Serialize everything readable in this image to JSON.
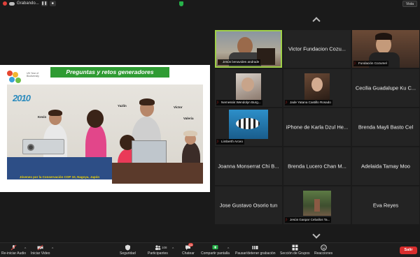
{
  "top": {
    "recording_label": "Grabando...",
    "view_label": "Vista"
  },
  "share": {
    "title": "Preguntas y retos generadores",
    "logo_text": "UN Year of Biodiversity",
    "logo_year": "2010",
    "names": [
      "Kevin",
      "Yazlin",
      "Victor",
      "Valeria",
      "Paula"
    ],
    "caption": "Jóvenes por la Conservación COP 10, Nagoya, Japón"
  },
  "gallery": [
    {
      "name": "Jesús benavides andrade",
      "kind": "video",
      "active": true
    },
    {
      "name": "Victor Fundacion Cozu...",
      "kind": "text",
      "active": false
    },
    {
      "name": "Fundación Cozumel",
      "kind": "video",
      "active": false
    },
    {
      "name": "Nemessis Wendolyn Burg...",
      "kind": "photo",
      "active": false
    },
    {
      "name": "Jade Yatana Castillo Rosado",
      "kind": "photo",
      "active": false
    },
    {
      "name": "Cecilia Guadalupe Ku C...",
      "kind": "text",
      "active": false
    },
    {
      "name": "Limberth Arceo",
      "kind": "photo",
      "active": false
    },
    {
      "name": "iPhone de Karla Dzul He...",
      "kind": "text",
      "active": false
    },
    {
      "name": "Brenda Mayli Basto Cel",
      "kind": "text",
      "active": false
    },
    {
      "name": "Joanna Monserrat Chi B...",
      "kind": "text",
      "active": false
    },
    {
      "name": "Brenda Lucero Chan M...",
      "kind": "text",
      "active": false
    },
    {
      "name": "Adelaida Tamay Moo",
      "kind": "text",
      "active": false
    },
    {
      "name": "Jose Gustavo Osorio tun",
      "kind": "text",
      "active": false
    },
    {
      "name": "Jesús Gaspar Ceballos Ta...",
      "kind": "photo",
      "active": false
    },
    {
      "name": "Eva Reyes",
      "kind": "text",
      "active": false
    }
  ],
  "toolbar": {
    "mute_label": "Re-iniciar Audio",
    "video_label": "Iniciar Video",
    "security_label": "Seguridad",
    "participants_label": "Participantes",
    "participants_count": "108",
    "chat_label": "Chatear",
    "chat_badge": "63",
    "share_label": "Compartir pantalla",
    "record_label": "Pausar/detener grabación",
    "rooms_label": "Sección de Grupos",
    "reactions_label": "Reacciones",
    "leave_label": "Salir"
  },
  "colors": {
    "active_border": "#9fd048",
    "leave": "#d92d2d",
    "share_green": "#27b24a",
    "title_green": "#2f9b33"
  }
}
